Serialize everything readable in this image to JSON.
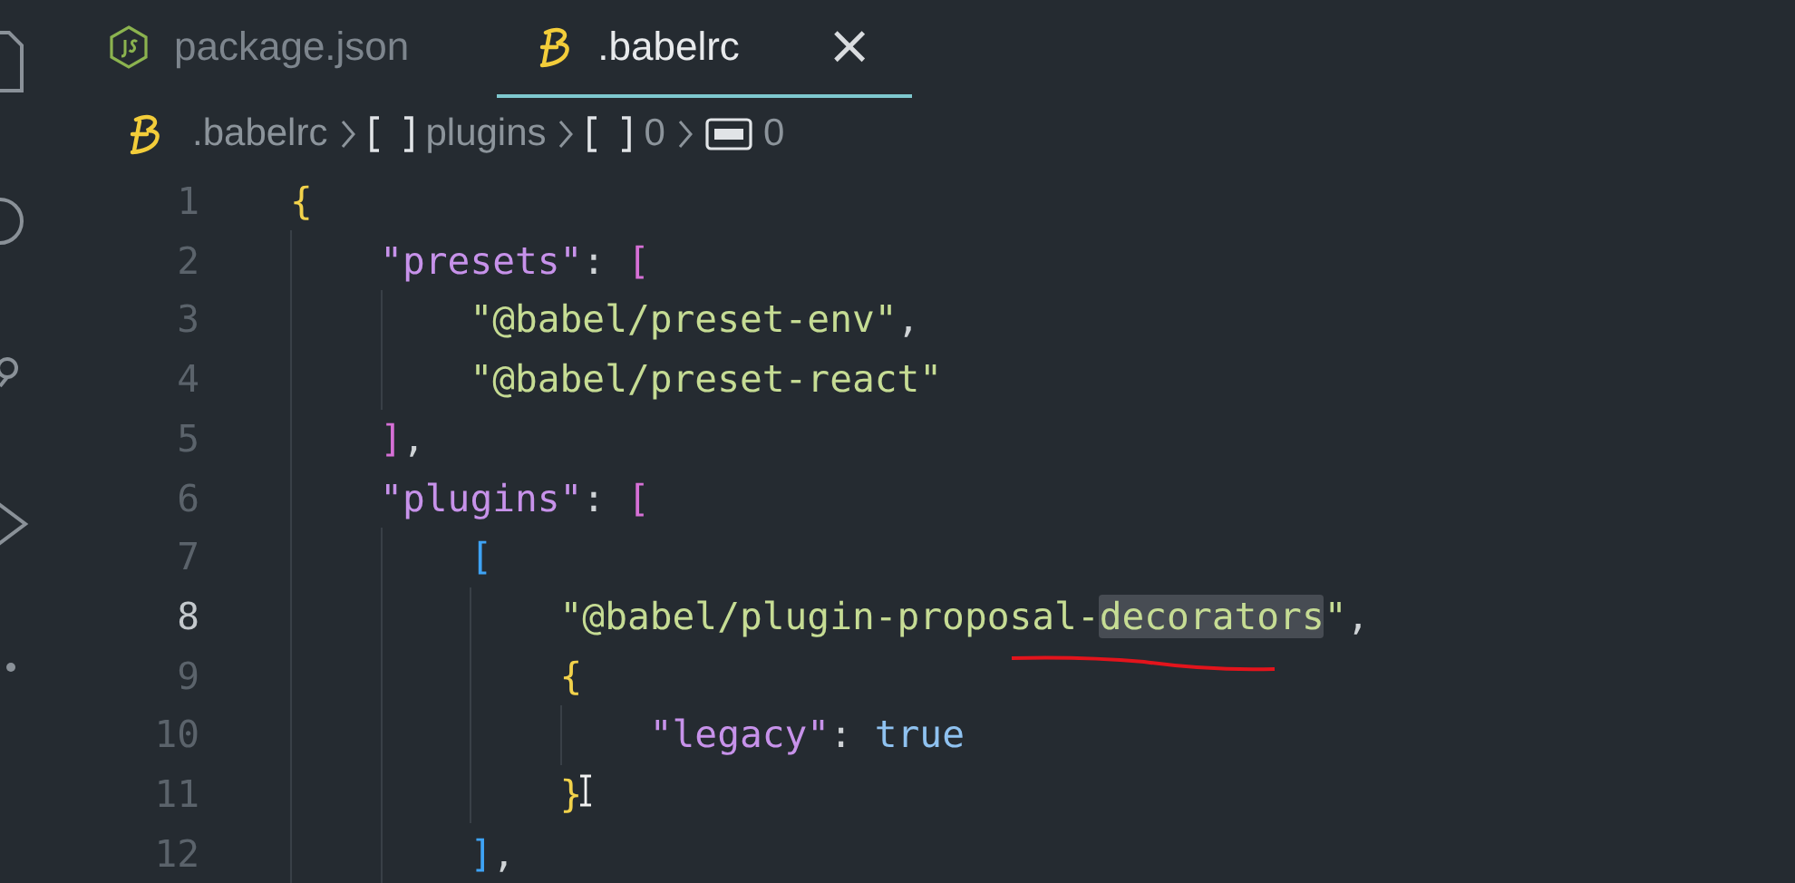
{
  "tabs": [
    {
      "label": "package.json",
      "kind": "js",
      "selected": false,
      "closable": false
    },
    {
      "label": ".babelrc",
      "kind": "babel",
      "selected": true,
      "closable": true,
      "close": "×"
    }
  ],
  "breadcrumb": [
    {
      "kind": "file",
      "label": ".babelrc"
    },
    {
      "kind": "array",
      "label": "plugins"
    },
    {
      "kind": "array",
      "label": "0"
    },
    {
      "kind": "string",
      "label": "0"
    }
  ],
  "editor": {
    "lines": [
      {
        "number": "1",
        "current": false,
        "tokens": [
          {
            "kind": "brace",
            "text": "{"
          }
        ],
        "children": [
          {
            "number": "2",
            "current": false,
            "tokens": [
              {
                "kind": "key",
                "text": "\"presets\""
              },
              {
                "kind": "punct",
                "text": ":"
              },
              {
                "kind": "bracket",
                "text": "["
              }
            ],
            "children": [
              {
                "number": "3",
                "current": false,
                "tokens": [
                  {
                    "kind": "string",
                    "text": "\"@babel/preset-env\""
                  },
                  {
                    "kind": "punct",
                    "text": ","
                  }
                ]
              },
              {
                "number": "4",
                "current": false,
                "tokens": [
                  {
                    "kind": "string",
                    "text": "\"@babel/preset-react\""
                  }
                ]
              }
            ]
          },
          {
            "number": "5",
            "current": false,
            "tokens": [
              {
                "kind": "bracket",
                "text": "]"
              },
              {
                "kind": "punct",
                "text": ","
              }
            ]
          },
          {
            "number": "6",
            "current": false,
            "tokens": [
              {
                "kind": "key",
                "text": "\"plugins\""
              },
              {
                "kind": "punct",
                "text": ":"
              },
              {
                "kind": "bracket",
                "text": "["
              }
            ],
            "children": [
              {
                "number": "7",
                "current": false,
                "tokens": [
                  {
                    "kind": "bracket-nested",
                    "text": "["
                  }
                ],
                "children": [
                  {
                    "number": "8",
                    "current": true,
                    "tokens": [
                      {
                        "kind": "string",
                        "text": "\"@babel/plugin-proposal-"
                      },
                      {
                        "kind": "string",
                        "text": "decorators",
                        "highlighted": true
                      },
                      {
                        "kind": "string",
                        "text": "\""
                      },
                      {
                        "kind": "punct",
                        "text": ","
                      }
                    ]
                  },
                  {
                    "number": "9",
                    "current": false,
                    "tokens": [
                      {
                        "kind": "brace",
                        "text": "{"
                      }
                    ],
                    "children": [
                      {
                        "number": "10",
                        "current": false,
                        "tokens": [
                          {
                            "kind": "key",
                            "text": "\"legacy\""
                          },
                          {
                            "kind": "punct",
                            "text": ":"
                          },
                          {
                            "kind": "bool",
                            "text": "true"
                          }
                        ]
                      }
                    ]
                  },
                  {
                    "number": "11",
                    "current": false,
                    "tokens": [
                      {
                        "kind": "brace",
                        "text": "}"
                      }
                    ]
                  }
                ]
              },
              {
                "number": "12",
                "current": false,
                "tokens": [
                  {
                    "kind": "bracket-nested",
                    "text": "]"
                  },
                  {
                    "kind": "punct",
                    "text": ","
                  }
                ]
              }
            ]
          }
        ]
      }
    ]
  }
}
